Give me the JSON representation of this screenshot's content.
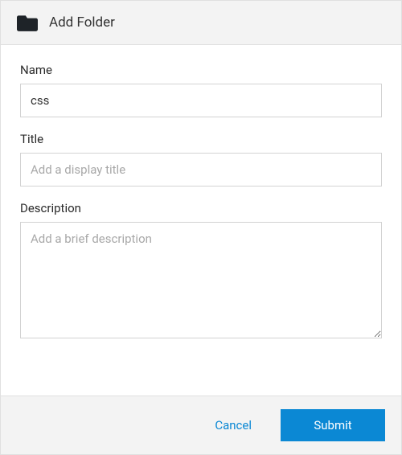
{
  "dialog": {
    "title": "Add Folder",
    "name": {
      "label": "Name",
      "value": "css"
    },
    "title_field": {
      "label": "Title",
      "value": "",
      "placeholder": "Add a display title"
    },
    "description": {
      "label": "Description",
      "value": "",
      "placeholder": "Add a brief description"
    },
    "actions": {
      "cancel": "Cancel",
      "submit": "Submit"
    }
  }
}
